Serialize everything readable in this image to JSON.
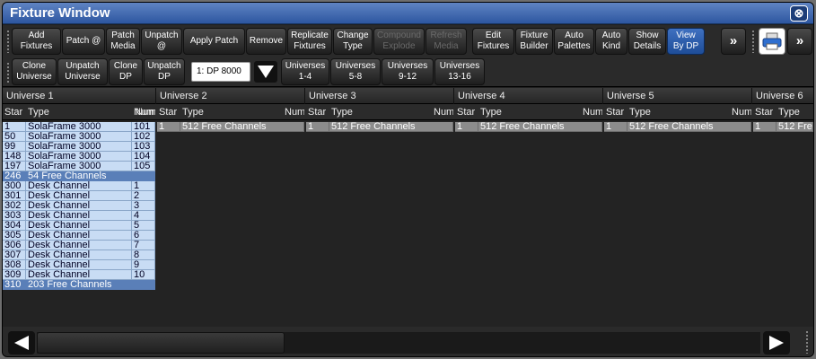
{
  "window": {
    "title": "Fixture Window",
    "close_glyph": "⊗"
  },
  "toolbar1": {
    "add_fixtures": "Add\nFixtures",
    "patch_at": "Patch @",
    "patch_media": "Patch\nMedia",
    "unpatch_at": "Unpatch\n@",
    "apply_patch": "Apply Patch",
    "remove": "Remove",
    "replicate_fixtures": "Replicate\nFixtures",
    "change_type": "Change\nType",
    "compound_explode": "Compound\nExplode",
    "refresh_media": "Refresh\nMedia",
    "edit_fixtures": "Edit\nFixtures",
    "fixture_builder": "Fixture\nBuilder",
    "auto_palettes": "Auto\nPalettes",
    "auto_kind": "Auto\nKind",
    "show_details": "Show\nDetails",
    "view_by_dp": "View\nBy DP",
    "more1": "»",
    "more2": "»"
  },
  "toolbar2": {
    "clone_universe": "Clone\nUniverse",
    "unpatch_universe": "Unpatch\nUniverse",
    "clone_dp": "Clone\nDP",
    "unpatch_dp": "Unpatch\nDP",
    "dp_select": "1: DP 8000",
    "universes_1_4": "Universes\n1-4",
    "universes_5_8": "Universes\n5-8",
    "universes_9_12": "Universes\n9-12",
    "universes_13_16": "Universes\n13-16"
  },
  "universes": [
    "Universe 1",
    "Universe 2",
    "Universe 3",
    "Universe 4",
    "Universe 5",
    "Universe 6"
  ],
  "columns": {
    "start": "Star",
    "type": "Type",
    "num": "Num"
  },
  "universe1_rows": [
    {
      "start": "1",
      "type": "SolaFrame 3000",
      "num": "101",
      "kind": "fix"
    },
    {
      "start": "50",
      "type": "SolaFrame 3000",
      "num": "102",
      "kind": "fix"
    },
    {
      "start": "99",
      "type": "SolaFrame 3000",
      "num": "103",
      "kind": "fix"
    },
    {
      "start": "148",
      "type": "SolaFrame 3000",
      "num": "104",
      "kind": "fix"
    },
    {
      "start": "197",
      "type": "SolaFrame 3000",
      "num": "105",
      "kind": "fix"
    },
    {
      "start": "246",
      "type": "54 Free Channels",
      "num": "",
      "kind": "free"
    },
    {
      "start": "300",
      "type": "Desk Channel",
      "num": "1",
      "kind": "fix"
    },
    {
      "start": "301",
      "type": "Desk Channel",
      "num": "2",
      "kind": "fix"
    },
    {
      "start": "302",
      "type": "Desk Channel",
      "num": "3",
      "kind": "fix"
    },
    {
      "start": "303",
      "type": "Desk Channel",
      "num": "4",
      "kind": "fix"
    },
    {
      "start": "304",
      "type": "Desk Channel",
      "num": "5",
      "kind": "fix"
    },
    {
      "start": "305",
      "type": "Desk Channel",
      "num": "6",
      "kind": "fix"
    },
    {
      "start": "306",
      "type": "Desk Channel",
      "num": "7",
      "kind": "fix"
    },
    {
      "start": "307",
      "type": "Desk Channel",
      "num": "8",
      "kind": "fix"
    },
    {
      "start": "308",
      "type": "Desk Channel",
      "num": "9",
      "kind": "fix"
    },
    {
      "start": "309",
      "type": "Desk Channel",
      "num": "10",
      "kind": "fix"
    },
    {
      "start": "310",
      "type": "203 Free Channels",
      "num": "",
      "kind": "free"
    }
  ],
  "other_universe_row": {
    "start": "1",
    "type": "512 Free Channels",
    "type_short": "512 Free"
  }
}
